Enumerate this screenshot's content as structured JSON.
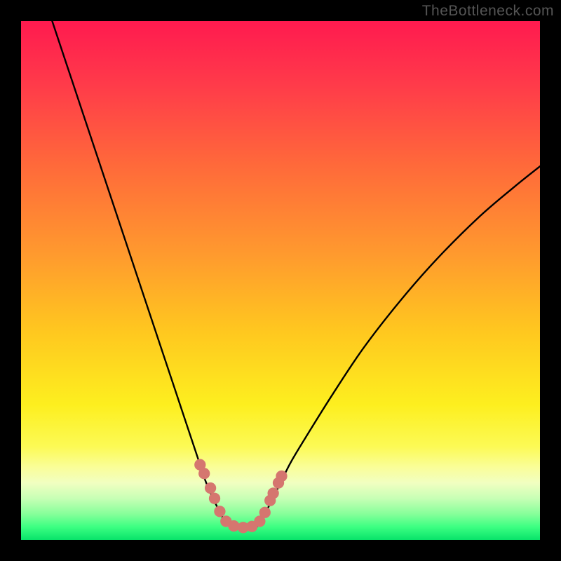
{
  "watermark": "TheBottleneck.com",
  "chart_data": {
    "type": "line",
    "title": "",
    "xlabel": "",
    "ylabel": "",
    "xlim": [
      0,
      100
    ],
    "ylim": [
      0,
      100
    ],
    "grid": false,
    "legend": false,
    "series": [
      {
        "name": "curve-left",
        "x": [
          6,
          10,
          14,
          18,
          22,
          26,
          30,
          32,
          34,
          35.5,
          37,
          38.5,
          39.5
        ],
        "y": [
          100,
          88,
          76,
          64,
          52,
          40,
          28,
          22,
          16,
          11.5,
          8,
          5,
          3
        ]
      },
      {
        "name": "curve-right",
        "x": [
          46,
          47,
          48.5,
          50,
          52,
          55,
          60,
          66,
          73,
          80,
          88,
          95,
          100
        ],
        "y": [
          3,
          5,
          8,
          11,
          15,
          20,
          28,
          37,
          46,
          54,
          62,
          68,
          72
        ]
      },
      {
        "name": "floor-band",
        "x": [
          39.5,
          41,
          43,
          45,
          46
        ],
        "y": [
          3,
          2.4,
          2.2,
          2.4,
          3
        ]
      }
    ],
    "markers": {
      "name": "worm",
      "color": "#d5766f",
      "points": [
        {
          "x": 34.5,
          "y": 14.5
        },
        {
          "x": 35.3,
          "y": 12.8
        },
        {
          "x": 36.5,
          "y": 10.0
        },
        {
          "x": 37.3,
          "y": 8.0
        },
        {
          "x": 38.3,
          "y": 5.5
        },
        {
          "x": 39.5,
          "y": 3.6
        },
        {
          "x": 41.0,
          "y": 2.7
        },
        {
          "x": 42.8,
          "y": 2.4
        },
        {
          "x": 44.5,
          "y": 2.6
        },
        {
          "x": 46.0,
          "y": 3.6
        },
        {
          "x": 47.0,
          "y": 5.3
        },
        {
          "x": 48.0,
          "y": 7.6
        },
        {
          "x": 48.6,
          "y": 9.0
        },
        {
          "x": 49.6,
          "y": 11.0
        },
        {
          "x": 50.2,
          "y": 12.3
        }
      ],
      "radius_data_units": 1.1
    },
    "gradient_stops": [
      {
        "offset": 0.0,
        "color": "#ff1a4f"
      },
      {
        "offset": 0.12,
        "color": "#ff3a4a"
      },
      {
        "offset": 0.28,
        "color": "#ff6a3a"
      },
      {
        "offset": 0.45,
        "color": "#ff9a2e"
      },
      {
        "offset": 0.6,
        "color": "#ffc81f"
      },
      {
        "offset": 0.74,
        "color": "#fdef1f"
      },
      {
        "offset": 0.82,
        "color": "#fcfa55"
      },
      {
        "offset": 0.86,
        "color": "#fafe99"
      },
      {
        "offset": 0.89,
        "color": "#f1ffc1"
      },
      {
        "offset": 0.92,
        "color": "#c7ffb5"
      },
      {
        "offset": 0.95,
        "color": "#86ff9a"
      },
      {
        "offset": 0.975,
        "color": "#3cff82"
      },
      {
        "offset": 1.0,
        "color": "#08e36a"
      }
    ]
  }
}
